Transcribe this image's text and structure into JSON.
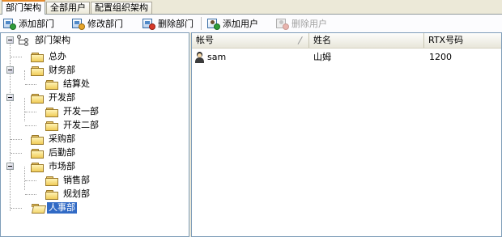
{
  "tabs": [
    {
      "label": "部门架构",
      "active": true
    },
    {
      "label": "全部用户",
      "active": false
    },
    {
      "label": "配置组织架构",
      "active": false
    }
  ],
  "toolbar": {
    "add_dept": "添加部门",
    "edit_dept": "修改部门",
    "delete_dept": "删除部门",
    "add_user": "添加用户",
    "delete_user": "删除用户"
  },
  "tree": {
    "root": "部门架构",
    "nodes": [
      {
        "label": "总办"
      },
      {
        "label": "财务部"
      },
      {
        "label": "结算处"
      },
      {
        "label": "开发部"
      },
      {
        "label": "开发一部"
      },
      {
        "label": "开发二部"
      },
      {
        "label": "采购部"
      },
      {
        "label": "后勤部"
      },
      {
        "label": "市场部"
      },
      {
        "label": "销售部"
      },
      {
        "label": "规划部"
      },
      {
        "label": "人事部",
        "selected": true
      }
    ]
  },
  "list": {
    "columns": [
      "帐号",
      "姓名",
      "RTX号码"
    ],
    "rows": [
      {
        "account": "sam",
        "name": "山姆",
        "rtx": "1200"
      }
    ]
  },
  "colors": {
    "selection": "#316ac5",
    "active_tab_accent": "#e68b2c",
    "folder": "#f0cc58"
  }
}
